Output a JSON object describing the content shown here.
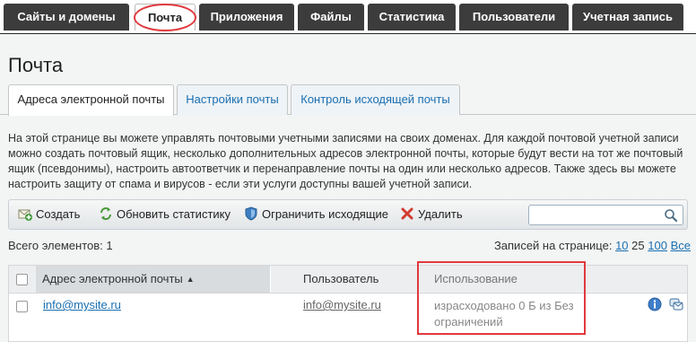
{
  "topnav": {
    "tabs": [
      {
        "label": "Сайты и домены",
        "active": false
      },
      {
        "label": "Почта",
        "active": true
      },
      {
        "label": "Приложения",
        "active": false
      },
      {
        "label": "Файлы",
        "active": false
      },
      {
        "label": "Статистика",
        "active": false
      },
      {
        "label": "Пользователи",
        "active": false
      },
      {
        "label": "Учетная запись",
        "active": false
      }
    ]
  },
  "page": {
    "title": "Почта"
  },
  "subtabs": [
    {
      "label": "Адреса электронной почты",
      "active": true
    },
    {
      "label": "Настройки почты",
      "active": false
    },
    {
      "label": "Контроль исходящей почты",
      "active": false
    }
  ],
  "description": "На этой странице вы можете управлять почтовыми учетными записями на своих доменах. Для каждой почтовой учетной записи можно создать почтовый ящик, несколько дополнительных адресов электронной почты, которые будут вести на тот же почтовый ящик (псевдонимы), настроить автоответчик и перенаправление почты на один или несколько адресов. Также здесь вы можете настроить защиту от спама и вирусов - если эти услуги доступны вашей учетной записи.",
  "toolbar": {
    "create_label": "Создать",
    "refresh_label": "Обновить статистику",
    "limit_label": "Ограничить исходящие",
    "delete_label": "Удалить",
    "search_placeholder": ""
  },
  "list": {
    "total_label": "Всего элементов: 1",
    "per_page_label": "Записей на странице:",
    "per_page_options": [
      "10",
      "25",
      "100",
      "Все"
    ],
    "per_page_selected": "25"
  },
  "table": {
    "columns": [
      "Адрес электронной почты",
      "Пользователь",
      "Использование"
    ],
    "rows": [
      {
        "email": "info@mysite.ru",
        "user": "info@mysite.ru",
        "usage": "израсходовано 0 Б из Без ограничений"
      }
    ]
  },
  "colors": {
    "nav_bg": "#3c3c3c",
    "link": "#1a6fb0",
    "annotation_red": "#e0393e"
  }
}
